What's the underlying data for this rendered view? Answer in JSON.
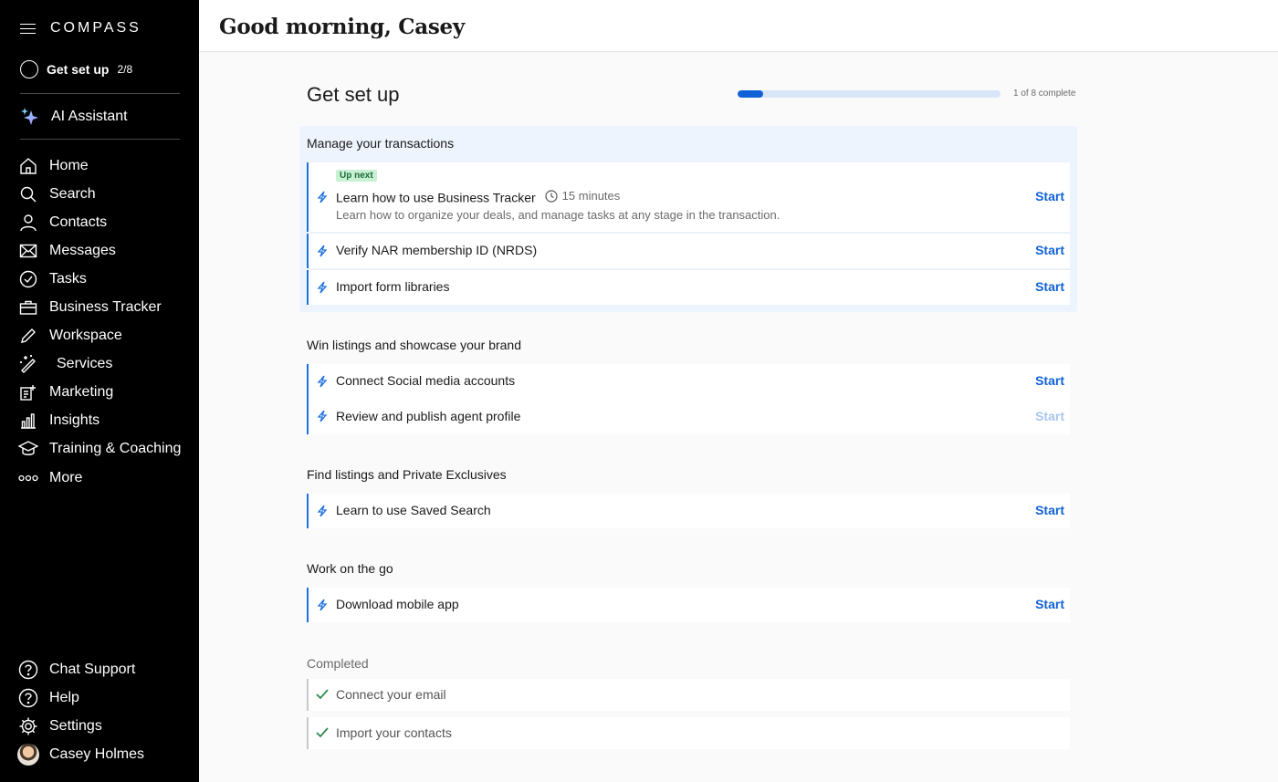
{
  "sidebar": {
    "brand": "COMPASS",
    "setup": {
      "label": "Get set up",
      "count": "2/8"
    },
    "ai": {
      "label": "AI Assistant"
    },
    "nav": [
      {
        "label": "Home",
        "icon": "home-icon"
      },
      {
        "label": "Search",
        "icon": "search-icon"
      },
      {
        "label": "Contacts",
        "icon": "contacts-icon"
      },
      {
        "label": "Messages",
        "icon": "mail-icon"
      },
      {
        "label": "Tasks",
        "icon": "check-circle-icon"
      },
      {
        "label": "Business Tracker",
        "icon": "briefcase-icon"
      },
      {
        "label": "Workspace",
        "icon": "pencil-icon"
      },
      {
        "label": "Services",
        "icon": "magic-wand-icon"
      },
      {
        "label": "Marketing",
        "icon": "marketing-icon"
      },
      {
        "label": "Insights",
        "icon": "bar-chart-icon"
      },
      {
        "label": "Training & Coaching",
        "icon": "graduation-cap-icon"
      },
      {
        "label": "More",
        "icon": "more-dots-icon"
      }
    ],
    "bottom": [
      {
        "label": "Chat Support",
        "icon": "chat-support-icon"
      },
      {
        "label": "Help",
        "icon": "help-icon"
      },
      {
        "label": "Settings",
        "icon": "gear-icon"
      },
      {
        "label": "Casey Holmes",
        "icon": "avatar"
      }
    ]
  },
  "header": {
    "greeting": "Good morning, Casey"
  },
  "main": {
    "title": "Get set up",
    "progress": {
      "fraction": 0.097,
      "text": "1 of 8 complete"
    },
    "sections": [
      {
        "title": "Manage your transactions",
        "tasks": [
          {
            "badge": "Up next",
            "label": "Learn how to use Business Tracker",
            "duration": "15 minutes",
            "description": "Learn how to organize your deals, and manage tasks at any stage in the transaction.",
            "action": "Start"
          },
          {
            "label": "Verify NAR membership ID (NRDS)",
            "action": "Start"
          },
          {
            "label": "Import form libraries",
            "action": "Start"
          }
        ]
      },
      {
        "title": "Win listings and showcase your brand",
        "tasks": [
          {
            "label": "Connect Social media accounts",
            "action": "Start"
          },
          {
            "label": "Review and publish agent profile",
            "action": "Start"
          }
        ]
      },
      {
        "title": "Find listings and Private Exclusives",
        "tasks": [
          {
            "label": "Learn to use Saved Search",
            "action": "Start"
          }
        ]
      },
      {
        "title": "Work on the go",
        "tasks": [
          {
            "label": "Download mobile app",
            "action": "Start"
          }
        ]
      }
    ],
    "completed": {
      "title": "Completed",
      "tasks": [
        {
          "label": "Connect your email"
        },
        {
          "label": "Import your contacts"
        }
      ]
    }
  },
  "colors": {
    "accent": "#0f62d6",
    "sidebar": "#000000",
    "highlight": "#edf4fd",
    "badge": "#c8f0d3"
  }
}
